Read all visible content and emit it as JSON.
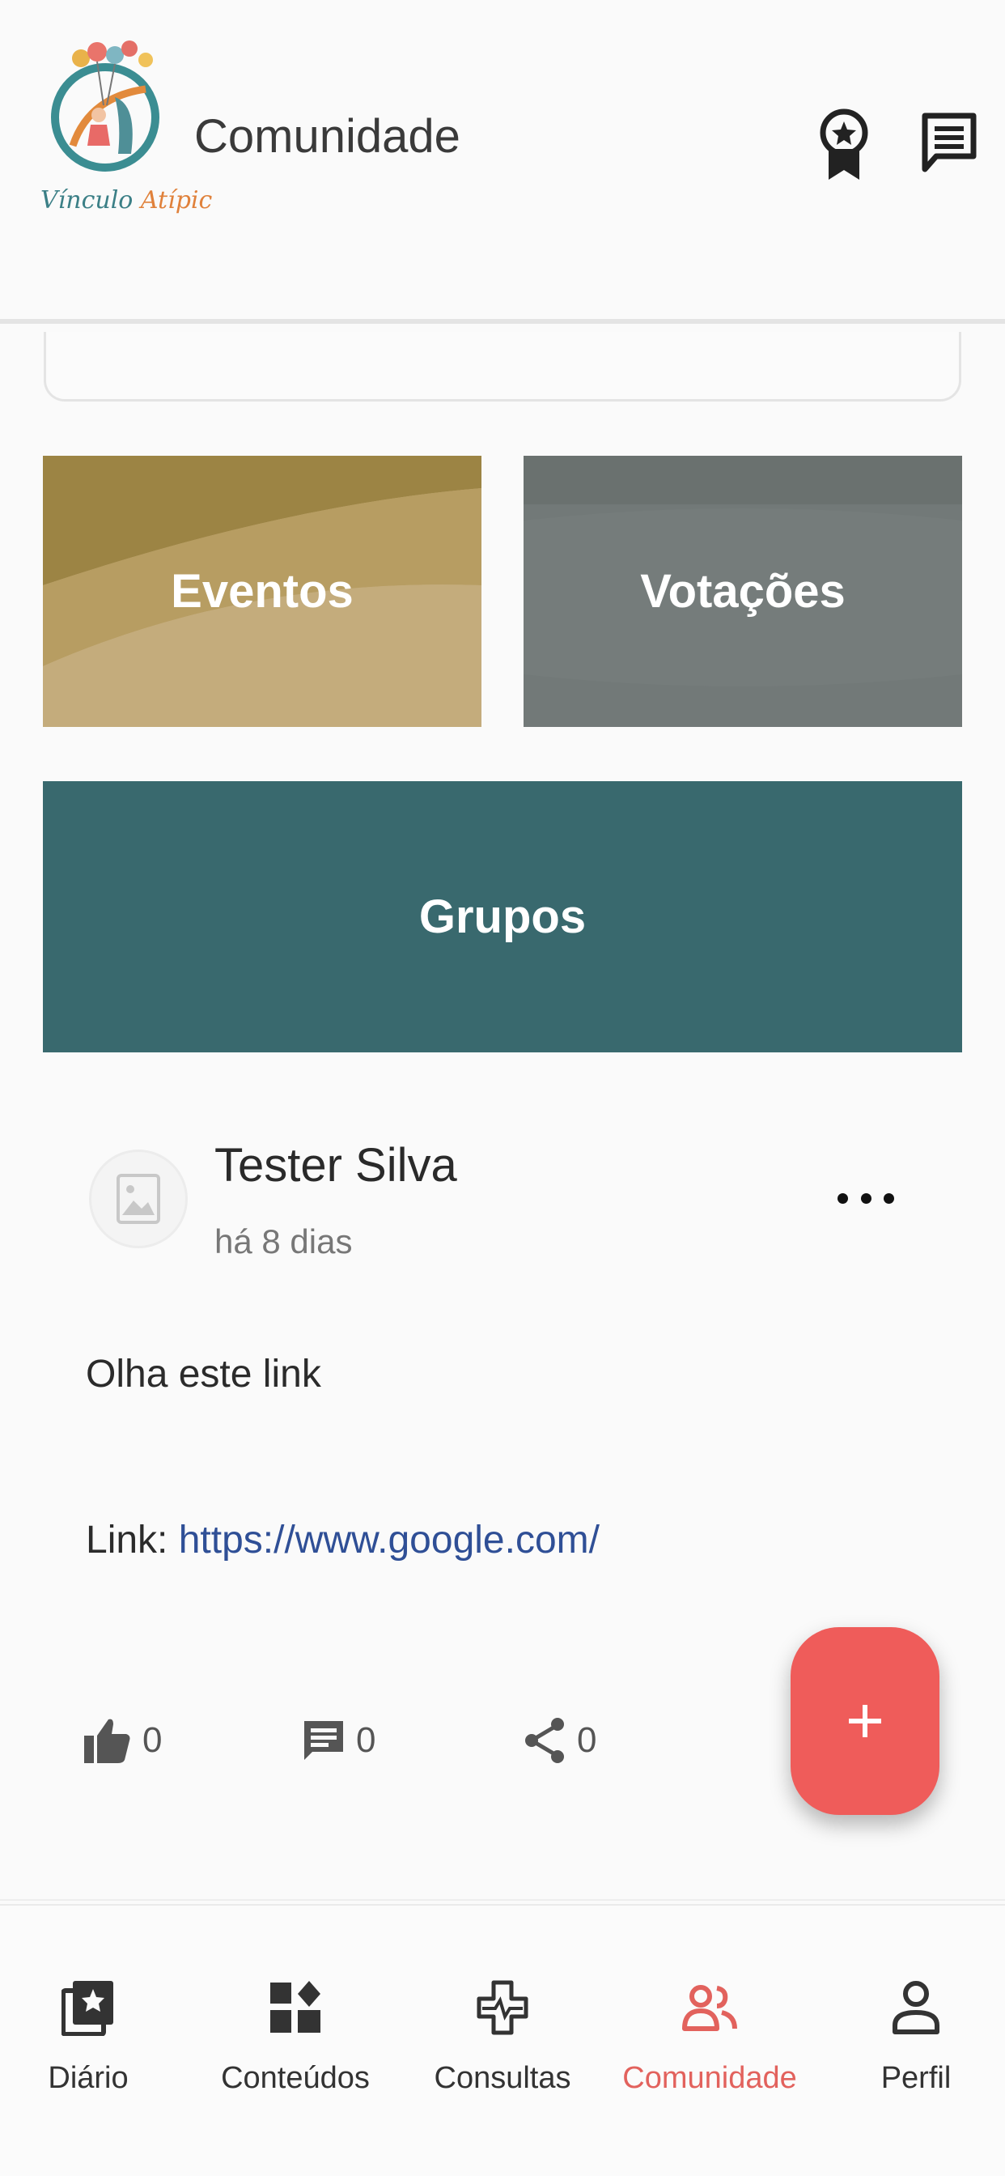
{
  "app": {
    "logo_text_1": "Vínculo",
    "logo_text_2": "Atípic",
    "title": "Comunidade"
  },
  "header_icons": [
    "badge-icon",
    "chat-icon"
  ],
  "tiles": {
    "eventos": "Eventos",
    "votacoes": "Votações",
    "grupos": "Grupos"
  },
  "post": {
    "author": "Tester Silva",
    "time": "há 8 dias",
    "text": "Olha este link",
    "link_label": "Link: ",
    "link_url": "https://www.google.com/",
    "likes": "0",
    "comments": "0",
    "shares": "0"
  },
  "fab": {
    "icon": "plus-icon"
  },
  "nav": {
    "diario": "Diário",
    "conteudos": "Conteúdos",
    "consultas": "Consultas",
    "comunidade": "Comunidade",
    "perfil": "Perfil"
  },
  "colors": {
    "accent": "#ef5c5a",
    "active_nav": "#e2625d",
    "eventos_tile": "#c4ac7c",
    "votacoes_tile": "#727978",
    "grupos_tile": "#39696e",
    "link": "#2f4f96"
  }
}
